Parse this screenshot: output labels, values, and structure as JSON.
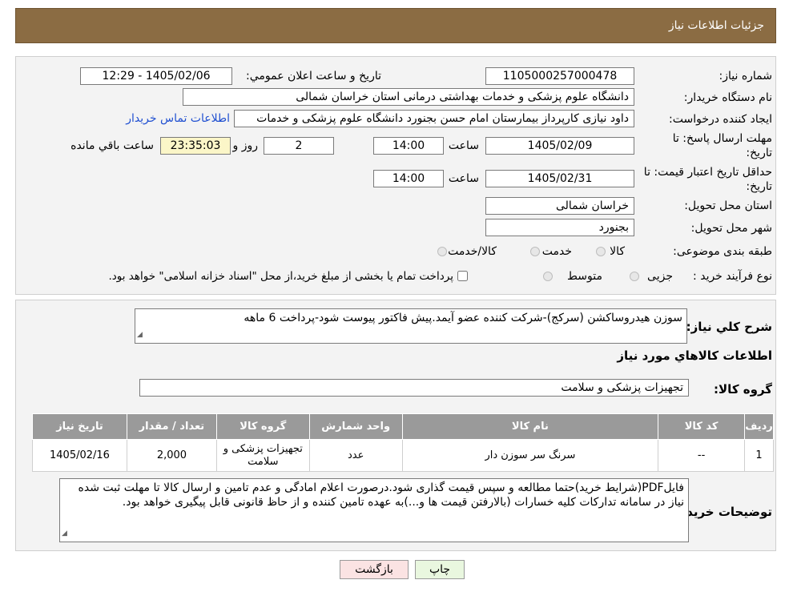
{
  "header": {
    "title": "جزئیات اطلاعات نیاز"
  },
  "details": {
    "need_number_label": "شماره نیاز:",
    "need_number": "1105000257000478",
    "announce_label": "تاریخ و ساعت اعلان عمومي:",
    "announce_value": "1405/02/06 - 12:29",
    "buyer_org_label": "نام دستگاه خریدار:",
    "buyer_org": "دانشگاه علوم پزشکی و خدمات بهداشتی درمانی استان خراسان شمالی",
    "creator_label": "ایجاد کننده درخواست:",
    "creator": "داود نیازی کارپرداز بیمارستان امام حسن بجنورد دانشگاه علوم پزشکی و خدمات",
    "contact_link": "اطلاعات تماس خریدار",
    "deadline_label_1": "مهلت ارسال پاسخ: تا",
    "deadline_label_2": "تاریخ:",
    "deadline_date": "1405/02/09",
    "time_label": "ساعت",
    "deadline_time": "14:00",
    "days_value": "2",
    "days_label": "روز و",
    "remaining_time": "23:35:03",
    "remaining_label": "ساعت باقي مانده",
    "validity_label_1": "حداقل تاریخ اعتبار قیمت: تا",
    "validity_label_2": "تاریخ:",
    "validity_date": "1405/02/31",
    "validity_time": "14:00",
    "province_label": "استان محل تحویل:",
    "province": "خراسان شمالی",
    "city_label": "شهر محل تحویل:",
    "city": "بجنورد",
    "category_label": "طبقه بندی موضوعی:",
    "category_options": [
      "کالا",
      "خدمت",
      "کالا/خدمت"
    ],
    "process_label": "نوع فرآیند خرید :",
    "process_options": [
      "جزیی",
      "متوسط"
    ],
    "process_note": "پرداخت تمام یا بخشی از مبلغ خرید،از محل \"اسناد خزانه اسلامی\" خواهد بود."
  },
  "description": {
    "label": "شرح کلي نیاز:",
    "value": "سوزن هیدروساکشن (سرکج)-شرکت کننده عضو آیمد.پیش فاکتور پیوست  شود-پرداخت 6 ماهه"
  },
  "goods": {
    "section_title": "اطلاعات کالاهاي مورد نیاز",
    "group_label": "گروه کالا:",
    "group_value": "تجهیزات پزشکی و سلامت",
    "columns": [
      "ردیف",
      "کد کالا",
      "نام کالا",
      "واحد شمارش",
      "گروه کالا",
      "تعداد / مقدار",
      "تاریخ نیاز"
    ],
    "rows": [
      [
        "1",
        "--",
        "سرنگ سر سوزن دار",
        "عدد",
        "تجهیزات پزشکی و سلامت",
        "2,000",
        "1405/02/16"
      ]
    ]
  },
  "buyer_notes": {
    "label": "توضیحات خریدار:",
    "value": "فایلPDF(شرایط خرید)حتما مطالعه و سپس قیمت گذاری شود.درصورت اعلام امادگی و عدم تامین و ارسال کالا تا مهلت ثبت شده نیاز در سامانه تدارکات کلیه خسارات (بالارفتن قیمت ها و...)به عهده تامین کننده و از حاظ قانونی قابل پیگیری خواهد بود."
  },
  "buttons": {
    "print": "چاپ",
    "back": "بازگشت"
  },
  "colors": {
    "header_bg": "#8b6c43",
    "link": "#1f4fd1",
    "time_bg": "#fbf6c8",
    "print_bg": "#e9f7df",
    "back_bg": "#fbe3e3"
  }
}
